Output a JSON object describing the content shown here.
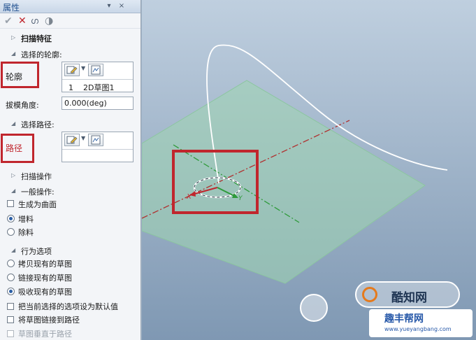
{
  "panel": {
    "title": "属性",
    "titlebar_buttons": {
      "pin": "▾",
      "close": "×"
    },
    "toolbar": {
      "ok_icon": "check-icon",
      "cancel_icon": "cross-icon",
      "preview_icon": "glasses-icon",
      "help_icon": "circle-icon"
    },
    "sections": {
      "sweep_feature": "扫描特征",
      "select_profile": "选择的轮廓:",
      "profile_label": "轮廓",
      "profile_list_item": "1    2D草图1",
      "draft_angle_label": "拔模角度:",
      "draft_angle_value": "0.000(deg)",
      "select_path": "选择路径:",
      "path_label": "路径",
      "sweep_operation": "扫描操作",
      "general_operation": "一般操作:",
      "generate_surface": "生成为曲面",
      "add_material": "增料",
      "remove_material": "除料",
      "behavior_options": "行为选项",
      "copy_sketch": "拷贝现有的草图",
      "link_sketch": "链接现有的草图",
      "absorb_sketch": "吸收现有的草图",
      "set_default": "把当前选择的选项设为默认值",
      "link_sketch_path": "将草图链接到路径",
      "sketch_perpendicular": "草图垂直于路径"
    }
  },
  "viewport": {
    "axis_x_label": "X",
    "axis_y_label": "Y",
    "watermark_brand": "酷知网",
    "watermark_url_text": "趣丰帮网",
    "watermark_domain": "www.yueyangbang.com"
  },
  "colors": {
    "highlight_red": "#c0262d",
    "plane_green": "#8fd0a8",
    "axis_red": "#b03030",
    "axis_green": "#2e9a3a"
  }
}
